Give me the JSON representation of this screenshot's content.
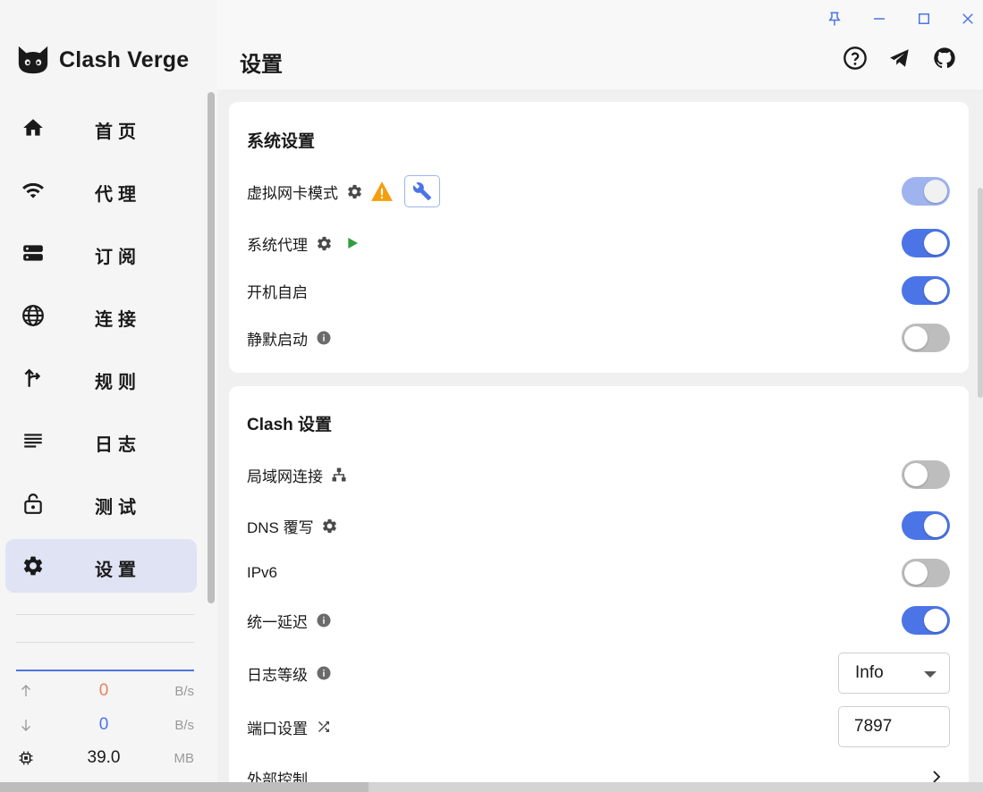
{
  "app": {
    "name": "Clash Verge"
  },
  "window": {
    "pin": "pin-icon",
    "minimize": "minimize-icon",
    "maximize": "maximize-icon",
    "close": "close-icon"
  },
  "sidebar": {
    "items": [
      {
        "label": "首页",
        "icon": "home-icon"
      },
      {
        "label": "代理",
        "icon": "wifi-icon"
      },
      {
        "label": "订阅",
        "icon": "storage-icon"
      },
      {
        "label": "连接",
        "icon": "globe-icon"
      },
      {
        "label": "规则",
        "icon": "fork-arrow-icon"
      },
      {
        "label": "日志",
        "icon": "list-icon"
      },
      {
        "label": "测试",
        "icon": "lock-open-icon"
      },
      {
        "label": "设置",
        "icon": "gear-icon",
        "active": true
      }
    ],
    "traffic": {
      "up": {
        "value": "0",
        "unit": "B/s",
        "color": "#e8815f"
      },
      "down": {
        "value": "0",
        "unit": "B/s",
        "color": "#4b74e6"
      },
      "memory": {
        "value": "39.0",
        "unit": "MB"
      }
    }
  },
  "header": {
    "title": "设置"
  },
  "system_settings": {
    "title": "系统设置",
    "tun_mode": {
      "label": "虚拟网卡模式",
      "enabled": true,
      "disabled_state": true
    },
    "system_proxy": {
      "label": "系统代理",
      "enabled": true
    },
    "auto_launch": {
      "label": "开机自启",
      "enabled": true
    },
    "silent_start": {
      "label": "静默启动",
      "enabled": false
    }
  },
  "clash_settings": {
    "title": "Clash 设置",
    "allow_lan": {
      "label": "局域网连接",
      "enabled": false
    },
    "dns_overwrite": {
      "label": "DNS 覆写",
      "enabled": true
    },
    "ipv6": {
      "label": "IPv6",
      "enabled": false
    },
    "unified_delay": {
      "label": "统一延迟",
      "enabled": true
    },
    "log_level": {
      "label": "日志等级",
      "value": "Info"
    },
    "port": {
      "label": "端口设置",
      "value": "7897"
    },
    "external_controller": {
      "label": "外部控制"
    }
  },
  "colors": {
    "accent": "#4b74e6",
    "active_nav": "#dfe3f4",
    "warning": "#f59e0b",
    "play": "#2e9e3f"
  }
}
